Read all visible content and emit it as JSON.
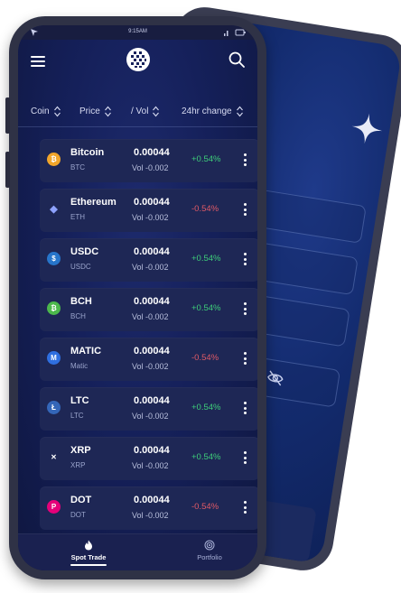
{
  "status_bar": {
    "time": "9:15AM"
  },
  "columns": [
    {
      "label": "Coin"
    },
    {
      "label": "Price"
    },
    {
      "label": "/ Vol"
    },
    {
      "label": "24hr change"
    }
  ],
  "coins": [
    {
      "name": "Bitcoin",
      "symbol": "BTC",
      "price": "0.00044",
      "vol": "Vol -0.002",
      "change": "+0.54%",
      "direction": "up",
      "icon": "bitcoin-icon",
      "color": "#f2a62b",
      "glyph": "₿"
    },
    {
      "name": "Ethereum",
      "symbol": "ETH",
      "price": "0.00044",
      "vol": "Vol -0.002",
      "change": "-0.54%",
      "direction": "down",
      "icon": "ethereum-icon",
      "color": "#1e2755",
      "glyph": "◆"
    },
    {
      "name": "USDC",
      "symbol": "USDC",
      "price": "0.00044",
      "vol": "Vol -0.002",
      "change": "+0.54%",
      "direction": "up",
      "icon": "usdc-icon",
      "color": "#2775ca",
      "glyph": "$"
    },
    {
      "name": "BCH",
      "symbol": "BCH",
      "price": "0.00044",
      "vol": "Vol -0.002",
      "change": "+0.54%",
      "direction": "up",
      "icon": "bitcoin-cash-icon",
      "color": "#4cb84c",
      "glyph": "₿"
    },
    {
      "name": "MATIC",
      "symbol": "Matic",
      "price": "0.00044",
      "vol": "Vol -0.002",
      "change": "-0.54%",
      "direction": "down",
      "icon": "matic-icon",
      "color": "#2f6fe0",
      "glyph": "M"
    },
    {
      "name": "LTC",
      "symbol": "LTC",
      "price": "0.00044",
      "vol": "Vol -0.002",
      "change": "+0.54%",
      "direction": "up",
      "icon": "litecoin-icon",
      "color": "#3466b8",
      "glyph": "Ł"
    },
    {
      "name": "XRP",
      "symbol": "XRP",
      "price": "0.00044",
      "vol": "Vol -0.002",
      "change": "+0.54%",
      "direction": "up",
      "icon": "xrp-icon",
      "color": "#23292f",
      "glyph": "✕"
    },
    {
      "name": "DOT",
      "symbol": "DOT",
      "price": "0.00044",
      "vol": "Vol -0.002",
      "change": "-0.54%",
      "direction": "down",
      "icon": "polkadot-icon",
      "color": "#e6007a",
      "glyph": "P"
    }
  ],
  "tabs": [
    {
      "label": "Spot Trade",
      "active": true,
      "icon": "flame-icon"
    },
    {
      "label": "Portfolio",
      "active": false,
      "icon": "portfolio-icon"
    }
  ],
  "colors": {
    "positive": "#3ecf7a",
    "negative": "#e05a66",
    "row_background": "#1e2755"
  }
}
